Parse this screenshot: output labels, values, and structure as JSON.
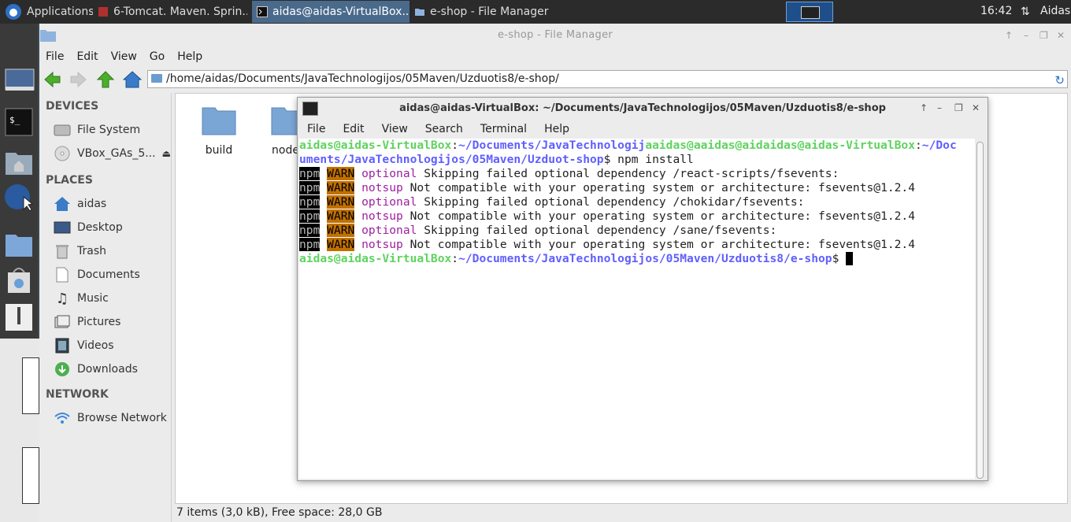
{
  "taskbar": {
    "applications_label": "Applications",
    "tasks": [
      {
        "label": "6-Tomcat. Maven. Sprin..."
      },
      {
        "label": "aidas@aidas-VirtualBox..."
      },
      {
        "label": "e-shop - File Manager"
      }
    ],
    "clock": "16:42",
    "user": "Aidas"
  },
  "file_manager": {
    "title": "e-shop - File Manager",
    "menu": [
      "File",
      "Edit",
      "View",
      "Go",
      "Help"
    ],
    "path": "/home/aidas/Documents/JavaTechnologijos/05Maven/Uzduotis8/e-shop/",
    "sidebar": {
      "devices_header": "DEVICES",
      "devices": [
        "File System",
        "VBox_GAs_5..."
      ],
      "places_header": "PLACES",
      "places": [
        "aidas",
        "Desktop",
        "Trash",
        "Documents",
        "Music",
        "Pictures",
        "Videos",
        "Downloads"
      ],
      "network_header": "NETWORK",
      "network": [
        "Browse Network"
      ]
    },
    "files": [
      "build",
      "node_"
    ],
    "status": "7 items (3,0 kB), Free space: 28,0 GB"
  },
  "terminal": {
    "title": "aidas@aidas-VirtualBox: ~/Documents/JavaTechnologijos/05Maven/Uzduotis8/e-shop",
    "menu": [
      "File",
      "Edit",
      "View",
      "Search",
      "Terminal",
      "Help"
    ],
    "line1_user": "aidas@aidas-VirtualBox",
    "line1_path_a": "~/Documents/JavaTechnologij",
    "line1_user2": "aaidas@aaidas@aidaidas@aidas-VirtualBox",
    "line1_path_b": "~/Doc",
    "line2_path": "uments/JavaTechnologijos/05Maven/Uzduot-shop",
    "line2_cmd": "$ npm install",
    "warnings": [
      {
        "npm": "npm",
        "warn": "WARN",
        "kind": "optional",
        "text": " Skipping failed optional dependency /react-scripts/fsevents:"
      },
      {
        "npm": "npm",
        "warn": "WARN",
        "kind": "notsup",
        "text": " Not compatible with your operating system or architecture: fsevents@1.2.4"
      },
      {
        "npm": "npm",
        "warn": "WARN",
        "kind": "optional",
        "text": " Skipping failed optional dependency /chokidar/fsevents:"
      },
      {
        "npm": "npm",
        "warn": "WARN",
        "kind": "notsup",
        "text": " Not compatible with your operating system or architecture: fsevents@1.2.4"
      },
      {
        "npm": "npm",
        "warn": "WARN",
        "kind": "optional",
        "text": " Skipping failed optional dependency /sane/fsevents:"
      },
      {
        "npm": "npm",
        "warn": "WARN",
        "kind": "notsup",
        "text": " Not compatible with your operating system or architecture: fsevents@1.2.4"
      }
    ],
    "prompt_user": "aidas@aidas-VirtualBox",
    "prompt_path": "~/Documents/JavaTechnologijos/05Maven/Uzduotis8/e-shop",
    "prompt_symbol": "$ "
  }
}
